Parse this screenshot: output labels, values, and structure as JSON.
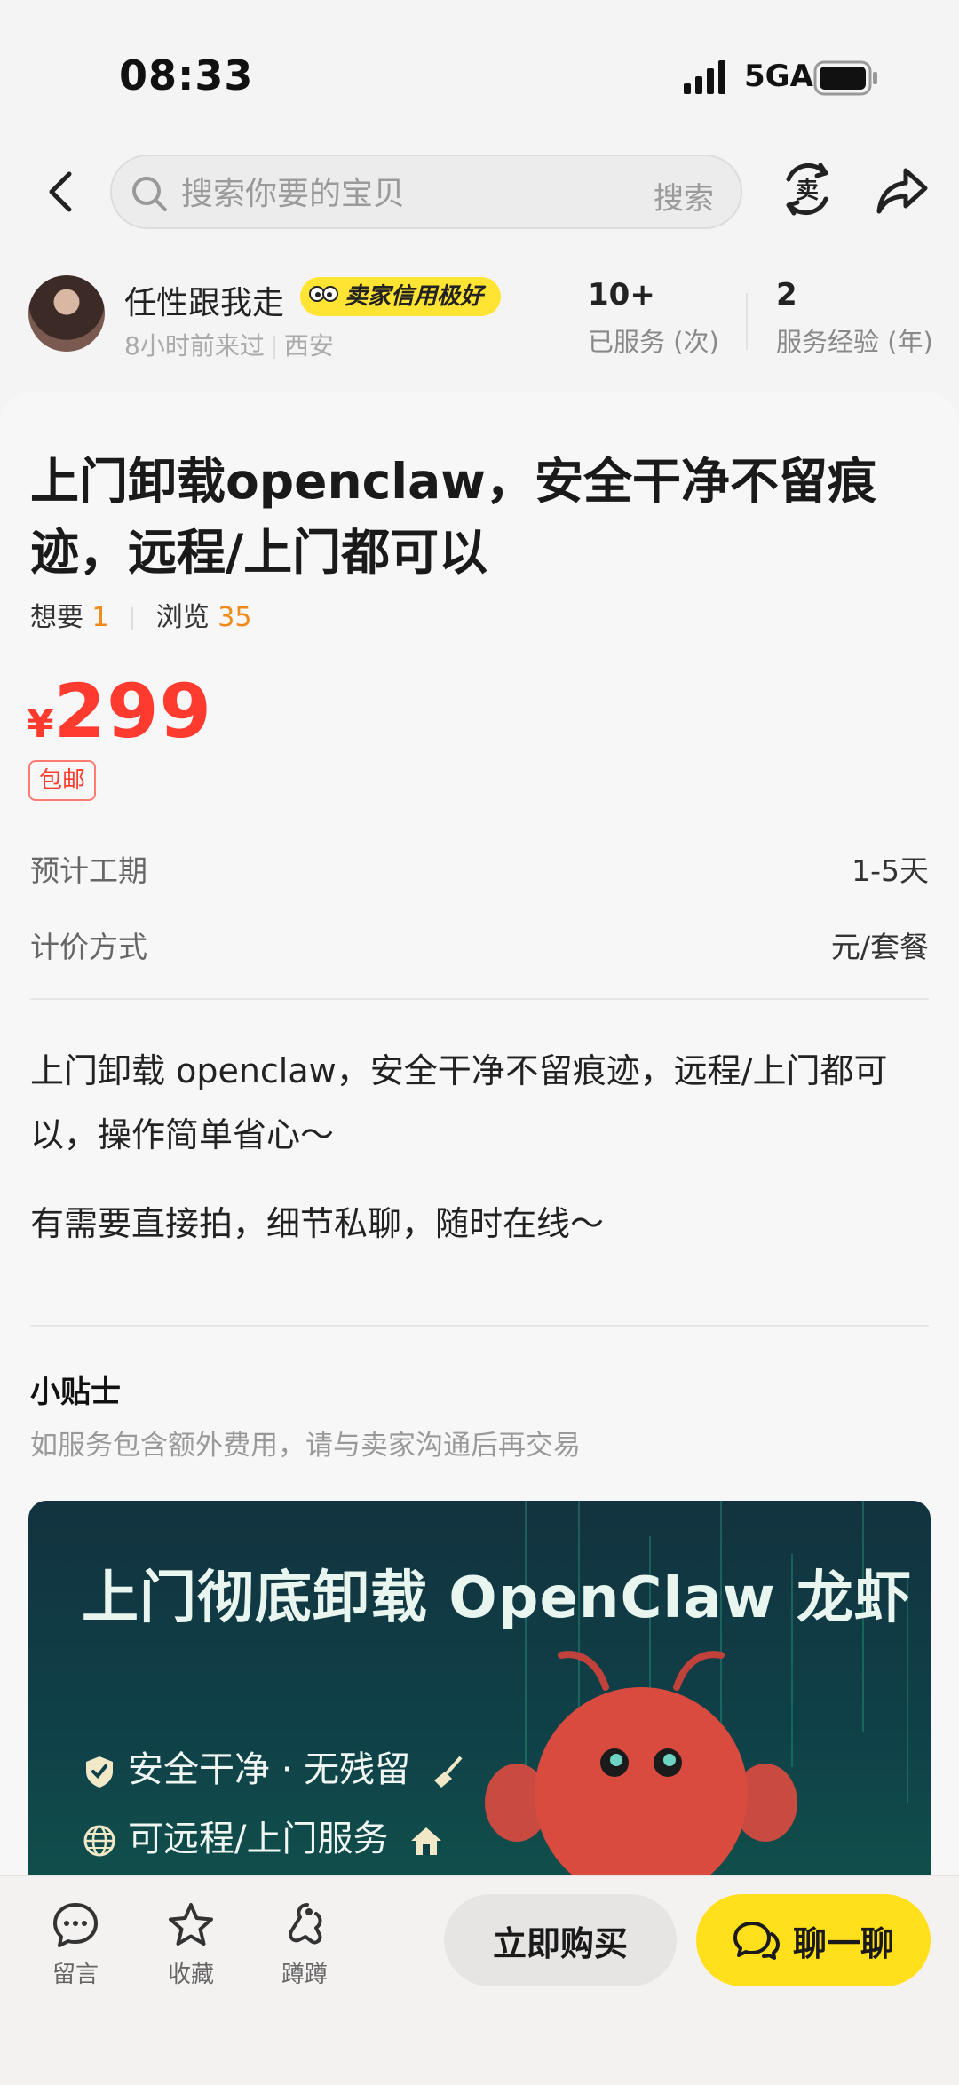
{
  "status_bar": {
    "time": "08:33",
    "network": "5GA",
    "icons": [
      "signal-icon",
      "battery-icon"
    ]
  },
  "nav": {
    "search_placeholder": "搜索你要的宝贝",
    "search_button": "搜索",
    "sell_icon_char": "卖",
    "icons": [
      "back-icon",
      "search-icon",
      "sell-icon",
      "share-icon"
    ]
  },
  "seller": {
    "name": "任性跟我走",
    "badge": "卖家信用极好",
    "last_seen": "8小时前来过",
    "location": "西安",
    "stats": [
      {
        "value": "10+",
        "label": "已服务 (次)"
      },
      {
        "value": "2",
        "label": "服务经验 (年)"
      }
    ]
  },
  "listing": {
    "title": "上门卸载openclaw，安全干净不留痕迹，远程/上门都可以",
    "want_label": "想要",
    "want_count": "1",
    "views_label": "浏览",
    "views_count": "35",
    "price_currency": "¥",
    "price": "299",
    "shipping": "包邮",
    "duration_label": "预计工期",
    "duration_value": "1-5天",
    "pricing_label": "计价方式",
    "pricing_value": "元/套餐",
    "description_1": "上门卸载 openclaw，安全干净不留痕迹，远程/上门都可以，操作简单省心～",
    "description_2": "有需要直接拍，细节私聊，随时在线～",
    "tips_title": "小贴士",
    "tips_text": "如服务包含额外费用，请与卖家沟通后再交易"
  },
  "banner": {
    "title": "上门彻底卸载 OpenClaw 龙虾",
    "line_1": "安全干净 · 无残留",
    "line_2": "可远程/上门服务",
    "colors": {
      "bg": "#0f4048",
      "mascot": "#d94a3f"
    }
  },
  "bottom_bar": {
    "actions": [
      {
        "label": "留言",
        "icon": "comment-icon"
      },
      {
        "label": "收藏",
        "icon": "star-icon"
      },
      {
        "label": "蹲蹲",
        "icon": "squat-icon"
      }
    ],
    "buy_label": "立即购买",
    "chat_label": "聊一聊",
    "colors": {
      "chat": "#ffe01b",
      "price": "#ff3b30",
      "accent": "#f08a1a"
    }
  }
}
